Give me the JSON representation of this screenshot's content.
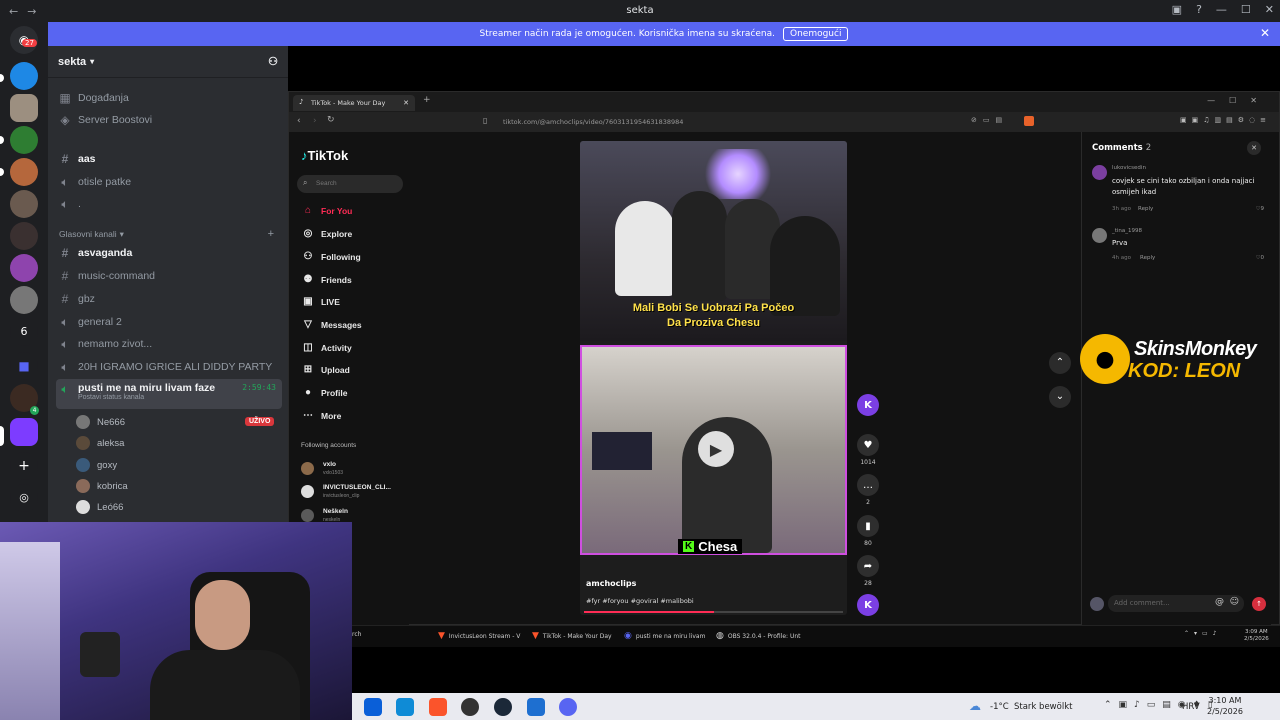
{
  "titlebar": {
    "title": "sekta",
    "back": "←",
    "forward": "→"
  },
  "rail": {
    "badge": "27",
    "number_server": "6",
    "online_count": "4"
  },
  "banner": {
    "text": "Streamer način rada je omogućen. Korisnička imena su skraćena.",
    "button": "Onemogući"
  },
  "sidebar": {
    "server_name": "sekta",
    "items": [
      {
        "label": "Događanja",
        "icon": "calendar-icon"
      },
      {
        "label": "Server Boostovi",
        "icon": "boost-icon"
      }
    ],
    "text_channels": [
      {
        "label": "aas",
        "unread": true
      },
      {
        "label": "otisle patke",
        "voice": true
      },
      {
        "label": ".",
        "voice": true
      }
    ],
    "voice_category": "Glasovni kanali",
    "voice_channels": [
      {
        "label": "asvaganda",
        "unread": true,
        "icon": "#"
      },
      {
        "label": "music-command",
        "icon": "#"
      },
      {
        "label": "gbz",
        "icon": "#"
      },
      {
        "label": "general 2",
        "icon": "speaker"
      },
      {
        "label": "nemamo zivot...",
        "icon": "speaker"
      },
      {
        "label": "20H IGRAMO IGRICE ALI DIDDY PARTY",
        "icon": "speaker"
      }
    ],
    "active_channel": {
      "label": "pusti me na miru livam faze",
      "timer": "2:59:43",
      "status": "Postavi status kanala"
    },
    "members": [
      {
        "name": "Ne666",
        "live": "UŽIVO"
      },
      {
        "name": "aleksa"
      },
      {
        "name": "goxy"
      },
      {
        "name": "kobrica"
      },
      {
        "name": "Leó66"
      }
    ]
  },
  "browser": {
    "tab_title": "TikTok - Make Your Day",
    "new_tab": "+",
    "url": "tiktok.com/@amchoclips/video/7603131954631838984"
  },
  "tiktok": {
    "logo": "TikTok",
    "search_placeholder": "Search",
    "nav": [
      {
        "label": "For You",
        "icon": "home-icon",
        "active": true
      },
      {
        "label": "Explore",
        "icon": "compass-icon"
      },
      {
        "label": "Following",
        "icon": "following-icon"
      },
      {
        "label": "Friends",
        "icon": "friends-icon"
      },
      {
        "label": "LIVE",
        "icon": "live-icon"
      },
      {
        "label": "Messages",
        "icon": "messages-icon"
      },
      {
        "label": "Activity",
        "icon": "activity-icon"
      },
      {
        "label": "Upload",
        "icon": "upload-icon"
      },
      {
        "label": "Profile",
        "icon": "profile-icon"
      },
      {
        "label": "More",
        "icon": "more-icon"
      }
    ],
    "following_header": "Following accounts",
    "following": [
      {
        "name": "vxlo",
        "handle": "vxlo1503"
      },
      {
        "name": "INVICTUSLEON_CLI...",
        "handle": "invictusleon_clip"
      },
      {
        "name": "Neškeln",
        "handle": "neskeln"
      }
    ],
    "video": {
      "caption_line1": "Mali Bobi Se Uobrazi Pa Počeo",
      "caption_line2": "Da Proziva Chesu",
      "overlay_name": "Chesa",
      "author": "amchoclips",
      "hashtags": "#fyr #foryou #goviral #malibobi"
    },
    "actions": {
      "likes": "1014",
      "comments": "2",
      "saves": "80",
      "shares": "28"
    },
    "comments": {
      "title": "Comments",
      "count": "2",
      "list": [
        {
          "user": "lukovicsedin",
          "text": "covjek se cini tako ozbiljan i onda najjaci osmijeh ikad",
          "time": "3h ago",
          "reply": "Reply",
          "likes": "9"
        },
        {
          "user": "_tina_1998",
          "text": "Prva",
          "time": "4h ago",
          "reply": "Reply",
          "likes": "0"
        }
      ],
      "add_placeholder": "Add comment...",
      "at_icon": "@"
    }
  },
  "sponsor": {
    "brand": "SkinsMonkey",
    "code": "KOD: LEON"
  },
  "inner_taskbar": {
    "search": "rch",
    "items": [
      "InvictusLeon Stream - V",
      "TikTok - Make Your Day",
      "pusti me na miru livam",
      "OBS 32.0.4 - Profile: Unt"
    ],
    "time": "3:09 AM",
    "date": "2/5/2026"
  },
  "taskbar": {
    "weather_temp": "-1°C",
    "weather_text": "Stark bewölkt",
    "lang": "HRV",
    "time": "3:10 AM",
    "date": "2/5/2026"
  }
}
